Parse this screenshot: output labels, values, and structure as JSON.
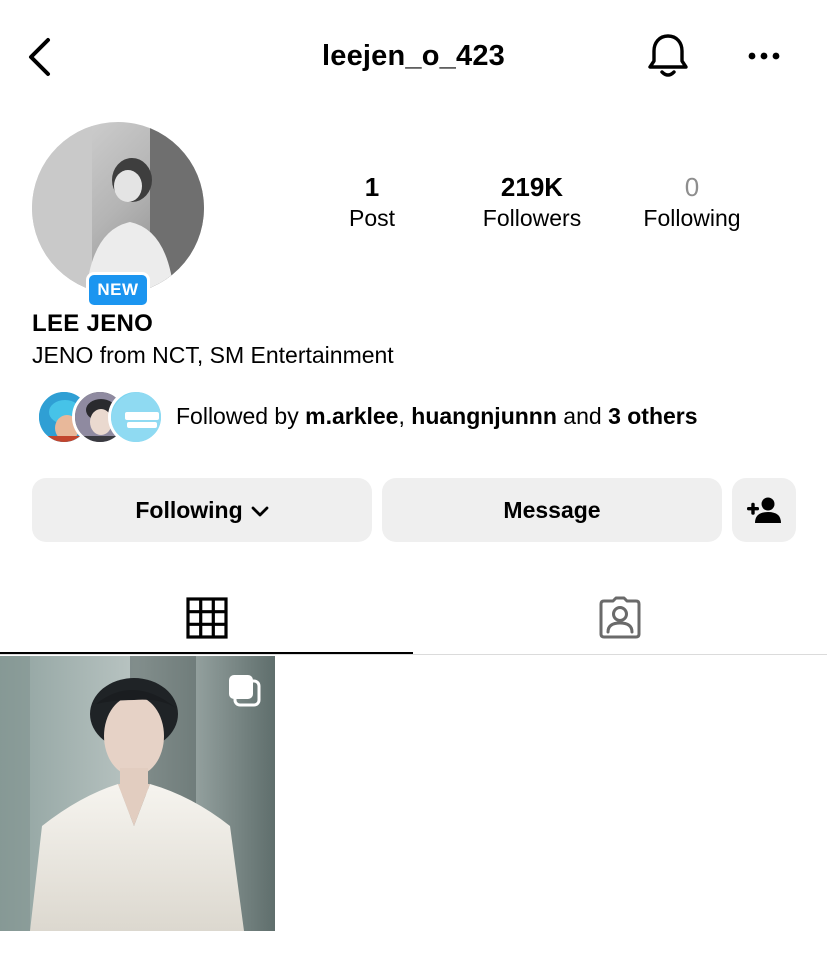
{
  "header": {
    "username": "leejen_o_423",
    "back_icon": "chevron-left-icon",
    "notification_icon": "bell-icon",
    "more_icon": "more-horizontal-icon"
  },
  "profile": {
    "avatar_badge": "NEW",
    "display_name": "LEE JENO",
    "bio": "JENO from NCT, SM Entertainment"
  },
  "stats": {
    "posts": {
      "count": "1",
      "label": "Post"
    },
    "followers": {
      "count": "219K",
      "label": "Followers"
    },
    "following": {
      "count": "0",
      "label": "Following"
    }
  },
  "followed_by": {
    "prefix": "Followed by ",
    "user1": "m.arklee",
    "separator": ", ",
    "user2": "huangnjunnn",
    "middle": " and ",
    "others": "3 others"
  },
  "actions": {
    "following_label": "Following",
    "message_label": "Message",
    "add_user_icon": "add-person-icon"
  },
  "tabs": {
    "grid_icon": "grid-icon",
    "tagged_icon": "tagged-person-icon",
    "active": "grid"
  },
  "colors": {
    "badge_blue": "#1b95f0",
    "button_gray": "#efefef",
    "muted_text": "#8e8e8e",
    "divider": "#dbdbdb"
  }
}
